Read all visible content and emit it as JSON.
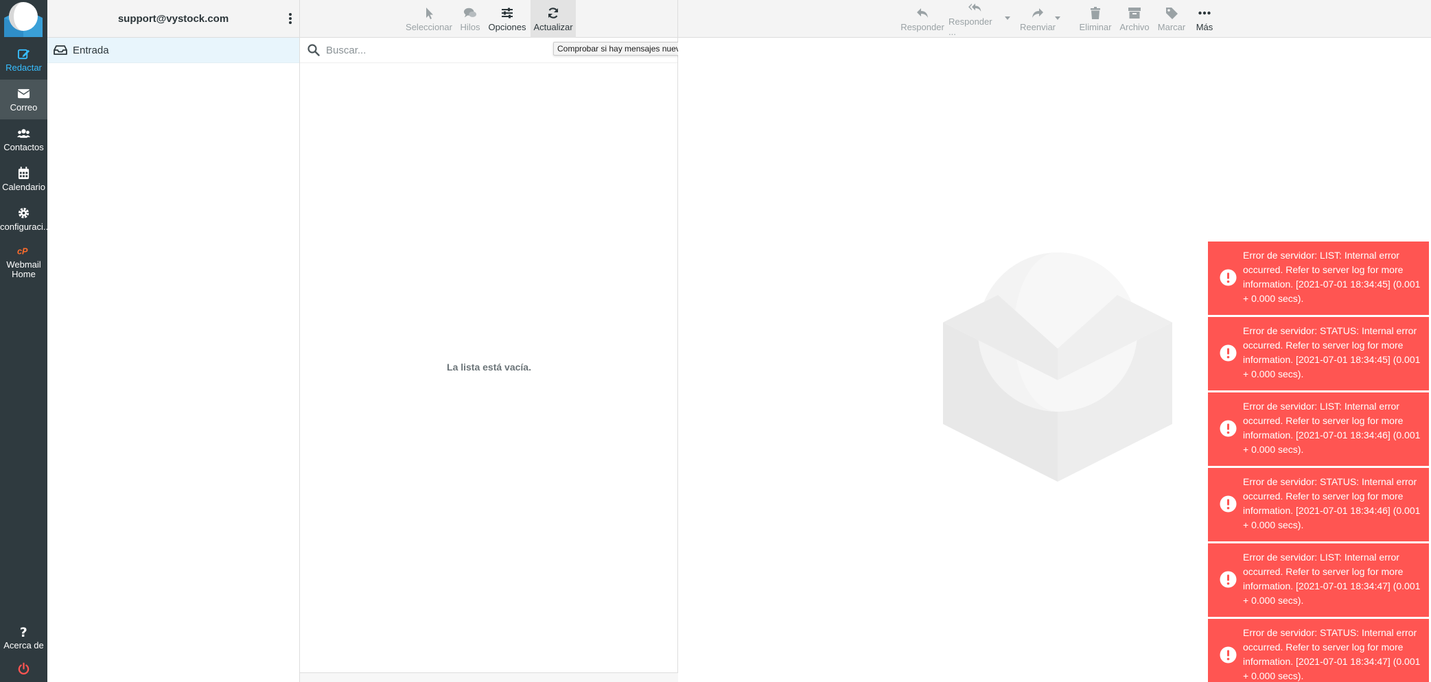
{
  "nav": {
    "items": [
      {
        "label": "Redactar",
        "icon": "compose-icon"
      },
      {
        "label": "Correo",
        "icon": "envelope-icon"
      },
      {
        "label": "Contactos",
        "icon": "users-icon"
      },
      {
        "label": "Calendario",
        "icon": "calendar-icon"
      },
      {
        "label": "configuraci...",
        "icon": "gear-icon"
      },
      {
        "label": "Webmail Home",
        "icon": "cpanel-icon"
      }
    ],
    "about_label": "Acerca de",
    "accent_color": "#37beff",
    "logout_color": "#ff5552"
  },
  "folders": {
    "account": "support@vystock.com",
    "items": [
      {
        "label": "Entrada",
        "icon": "inbox-icon",
        "selected": true
      }
    ]
  },
  "list_toolbar": {
    "select_label": "Seleccionar",
    "threads_label": "Hilos",
    "options_label": "Opciones",
    "refresh_label": "Actualizar"
  },
  "search": {
    "placeholder": "Buscar..."
  },
  "tooltip": "Comprobar si hay mensajes nuevos",
  "list": {
    "empty_text": "La lista está vacía."
  },
  "content_toolbar": {
    "reply_label": "Responder",
    "reply_all_label": "Responder ...",
    "forward_label": "Reenviar",
    "delete_label": "Eliminar",
    "archive_label": "Archivo",
    "mark_label": "Marcar",
    "more_label": "Más"
  },
  "errors": [
    "Error de servidor: LIST: Internal error occurred. Refer to server log for more information. [2021-07-01 18:34:45] (0.001 + 0.000 secs).",
    "Error de servidor: STATUS: Internal error occurred. Refer to server log for more information. [2021-07-01 18:34:45] (0.001 + 0.000 secs).",
    "Error de servidor: LIST: Internal error occurred. Refer to server log for more information. [2021-07-01 18:34:46] (0.001 + 0.000 secs).",
    "Error de servidor: STATUS: Internal error occurred. Refer to server log for more information. [2021-07-01 18:34:46] (0.001 + 0.000 secs).",
    "Error de servidor: LIST: Internal error occurred. Refer to server log for more information. [2021-07-01 18:34:47] (0.001 + 0.000 secs).",
    "Error de servidor: STATUS: Internal error occurred. Refer to server log for more information. [2021-07-01 18:34:47] (0.001 + 0.000 secs)."
  ],
  "colors": {
    "error_bg": "#ff5552",
    "sidebar_bg": "#2f3a3f",
    "selected_folder_bg": "#e8f5fc"
  }
}
